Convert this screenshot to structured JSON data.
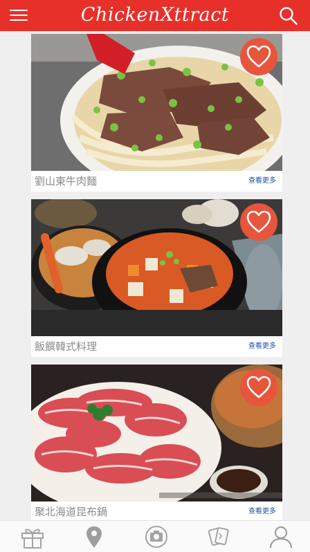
{
  "header": {
    "brand": "ChickenXttract",
    "menu_icon": "hamburger-menu-icon",
    "search_icon": "search-icon",
    "bar_color": "#e8302a"
  },
  "cards": [
    {
      "name": "劉山東牛肉麵",
      "more_label": "查看更多",
      "photo": "beef-noodle-soup-photo"
    },
    {
      "name": "飯饌韓式料理",
      "more_label": "查看更多",
      "photo": "korean-stew-photo"
    },
    {
      "name": "聚北海道昆布鍋",
      "more_label": "查看更多",
      "photo": "hotpot-meat-photo"
    }
  ],
  "favorite_icon": "heart-icon",
  "favorite_color": "#e8553d",
  "link_color": "#1e4fa3",
  "tabbar": {
    "icons": [
      "gift-icon",
      "location-pin-icon",
      "camera-icon",
      "cards-icon",
      "user-icon"
    ]
  }
}
